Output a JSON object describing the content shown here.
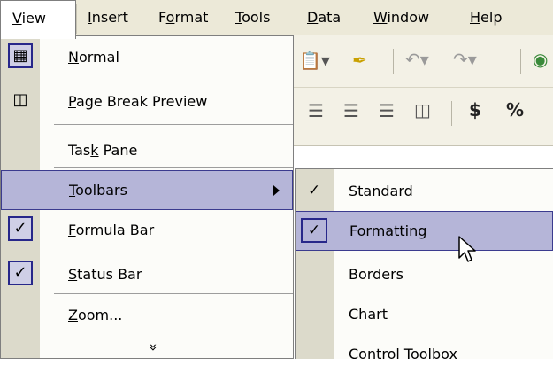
{
  "menubar": {
    "items": [
      {
        "label": "View",
        "active": true
      },
      {
        "label": "Insert"
      },
      {
        "label": "Format"
      },
      {
        "label": "Tools"
      },
      {
        "label": "Data"
      },
      {
        "label": "Window"
      },
      {
        "label": "Help"
      }
    ]
  },
  "view_menu": {
    "items": [
      {
        "label": "Normal",
        "icon": "normal-view-icon"
      },
      {
        "label": "Page Break Preview",
        "icon": "page-break-preview-icon"
      },
      {
        "label": "Task Pane"
      },
      {
        "label": "Toolbars",
        "highlighted": true,
        "submenu": true
      },
      {
        "label": "Formula Bar",
        "checked": true
      },
      {
        "label": "Status Bar",
        "checked": true
      },
      {
        "label": "Zoom..."
      }
    ],
    "expand_glyph": "»"
  },
  "toolbars_submenu": {
    "items": [
      {
        "label": "Standard",
        "checked": true
      },
      {
        "label": "Formatting",
        "checked": true,
        "highlighted": true
      },
      {
        "label": "Borders"
      },
      {
        "label": "Chart"
      },
      {
        "label": "Control Toolbox"
      }
    ]
  },
  "toolbar_glyphs": {
    "currency": "$",
    "percent": "%"
  },
  "colors": {
    "menubar_bg": "#ece9d8",
    "highlight_bg": "#b5b5d8",
    "highlight_border": "#3b3b8f",
    "gutter_bg": "#dcdacb"
  }
}
